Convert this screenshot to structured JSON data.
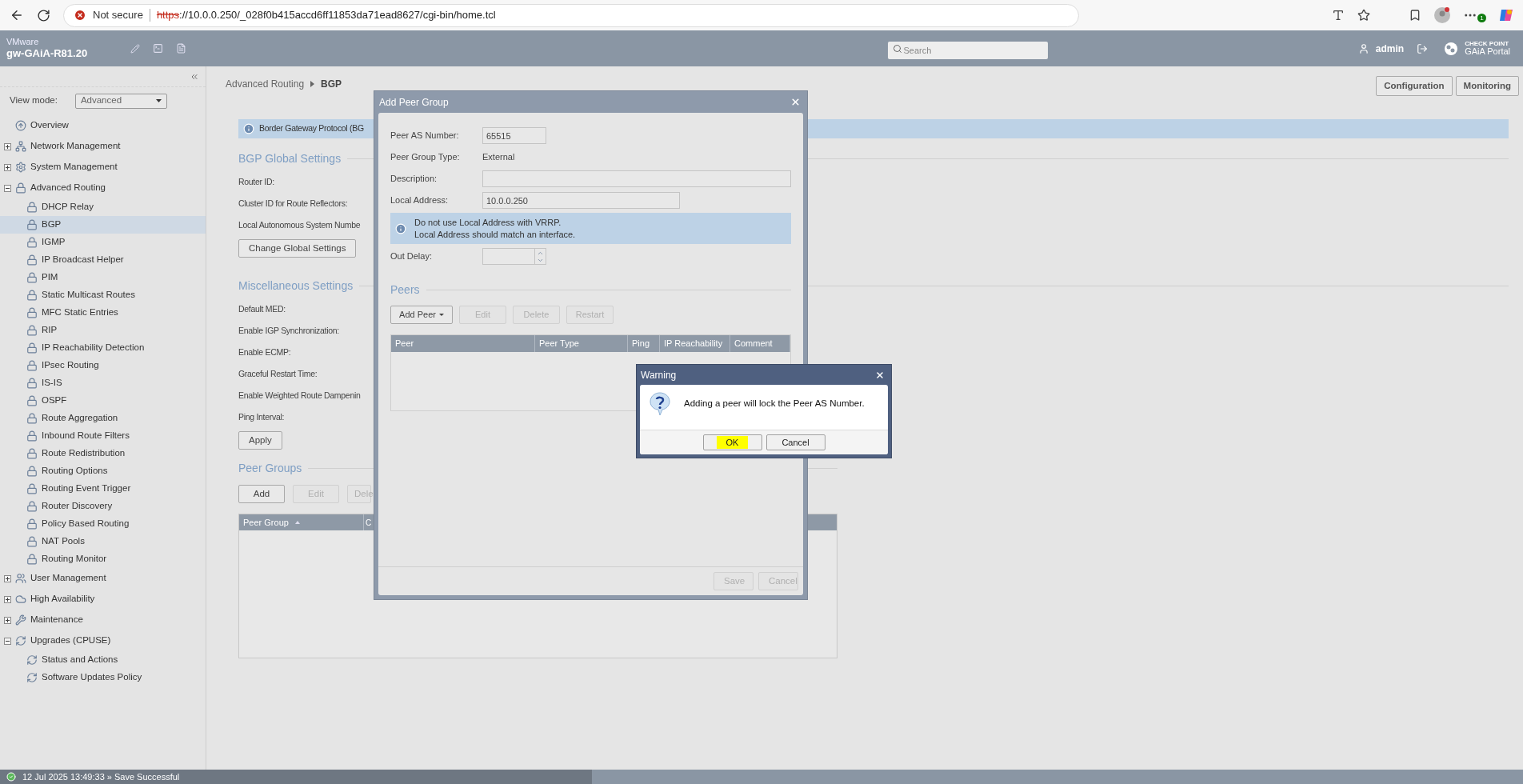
{
  "browser": {
    "security": "Not secure",
    "url_scheme": "https",
    "url_rest": "://10.0.0.250/_028f0b415accd6ff11853da71ead8627/cgi-bin/home.tcl",
    "badge": "1"
  },
  "header": {
    "vendor": "VMware",
    "hostname": "gw-GAiA-R81.20",
    "search_placeholder": "Search",
    "user": "admin",
    "brand_small": "CHECK POINT",
    "brand": "GAiA Portal"
  },
  "sidebar": {
    "view_mode_label": "View mode:",
    "view_mode": "Advanced",
    "items": [
      {
        "label": "Overview",
        "kind": "overview",
        "selected": false
      },
      {
        "label": "Network Management",
        "kind": "network",
        "expanded": false,
        "selected": false
      },
      {
        "label": "System Management",
        "kind": "system",
        "expanded": false,
        "selected": false
      },
      {
        "label": "Advanced Routing",
        "kind": "routing",
        "expanded": true,
        "selected": false,
        "children": [
          {
            "label": "DHCP Relay",
            "kind": "routing",
            "selected": false
          },
          {
            "label": "BGP",
            "kind": "routing",
            "selected": true
          },
          {
            "label": "IGMP",
            "kind": "routing",
            "selected": false
          },
          {
            "label": "IP Broadcast Helper",
            "kind": "routing",
            "selected": false
          },
          {
            "label": "PIM",
            "kind": "routing",
            "selected": false
          },
          {
            "label": "Static Multicast Routes",
            "kind": "routing",
            "selected": false
          },
          {
            "label": "MFC Static Entries",
            "kind": "routing",
            "selected": false
          },
          {
            "label": "RIP",
            "kind": "routing",
            "selected": false
          },
          {
            "label": "IP Reachability Detection",
            "kind": "routing",
            "selected": false
          },
          {
            "label": "IPsec Routing",
            "kind": "routing",
            "selected": false
          },
          {
            "label": "IS-IS",
            "kind": "routing",
            "selected": false
          },
          {
            "label": "OSPF",
            "kind": "routing",
            "selected": false
          },
          {
            "label": "Route Aggregation",
            "kind": "routing",
            "selected": false
          },
          {
            "label": "Inbound Route Filters",
            "kind": "routing",
            "selected": false
          },
          {
            "label": "Route Redistribution",
            "kind": "routing",
            "selected": false
          },
          {
            "label": "Routing Options",
            "kind": "routing",
            "selected": false
          },
          {
            "label": "Routing Event Trigger",
            "kind": "routing",
            "selected": false
          },
          {
            "label": "Router Discovery",
            "kind": "routing",
            "selected": false
          },
          {
            "label": "Policy Based Routing",
            "kind": "routing",
            "selected": false
          },
          {
            "label": "NAT Pools",
            "kind": "routing",
            "selected": false
          },
          {
            "label": "Routing Monitor",
            "kind": "routing",
            "selected": false
          }
        ]
      },
      {
        "label": "User Management",
        "kind": "users",
        "expanded": false,
        "selected": false
      },
      {
        "label": "High Availability",
        "kind": "cloud",
        "expanded": false,
        "selected": false
      },
      {
        "label": "Maintenance",
        "kind": "wrench",
        "expanded": false,
        "selected": false
      },
      {
        "label": "Upgrades (CPUSE)",
        "kind": "refresh",
        "expanded": true,
        "selected": false,
        "children": [
          {
            "label": "Status and Actions",
            "kind": "refresh",
            "selected": false
          },
          {
            "label": "Software Updates Policy",
            "kind": "refresh",
            "selected": false
          }
        ]
      }
    ]
  },
  "breadcrumb": [
    "Advanced Routing",
    "BGP"
  ],
  "mode_buttons": [
    {
      "label": "Configuration"
    },
    {
      "label": "Monitoring"
    }
  ],
  "info_text": "Border Gateway Protocol (BG",
  "sections": [
    {
      "title": "BGP Global Settings",
      "fields": [
        "Router ID:",
        "Cluster ID for Route Reflectors:",
        "Local Autonomous System Numbe"
      ],
      "button": "Change Global Settings"
    },
    {
      "title": "Miscellaneous Settings",
      "fields": [
        "Default MED:",
        "Enable IGP Synchronization:",
        "Enable ECMP:",
        "Graceful Restart Time:",
        "Enable Weighted Route Dampenin",
        "Ping Interval:"
      ],
      "button": "Apply"
    }
  ],
  "peer_groups": {
    "title": "Peer Groups",
    "buttons": [
      {
        "label": "Add",
        "disabled": false
      },
      {
        "label": "Edit",
        "disabled": true
      },
      {
        "label": "Dele",
        "disabled": true
      }
    ],
    "columns": [
      "Peer Group",
      "C"
    ]
  },
  "dialog": {
    "title": "Add Peer Group",
    "fields": [
      {
        "kind": "input",
        "label": "Peer AS Number:",
        "value": "65515"
      },
      {
        "kind": "text",
        "label": "Peer Group Type:",
        "value": "External"
      },
      {
        "kind": "input",
        "label": "Description:"
      },
      {
        "kind": "input",
        "label": "Local Address:",
        "value": "10.0.0.250"
      },
      {
        "kind": "note",
        "lines": [
          "Do not use Local Address with VRRP.",
          "Local Address should match an interface."
        ]
      },
      {
        "kind": "spin",
        "label": "Out Delay:"
      }
    ],
    "peers_title": "Peers",
    "peer_buttons": [
      {
        "label": "Add Peer",
        "dropdown": true,
        "disabled": false
      },
      {
        "label": "Edit",
        "disabled": true
      },
      {
        "label": "Delete",
        "disabled": true
      },
      {
        "label": "Restart",
        "disabled": true
      }
    ],
    "columns": [
      "Peer",
      "Peer Type",
      "Ping",
      "IP Reachability",
      "Comment"
    ],
    "footer_buttons": [
      {
        "label": "Save",
        "disabled": true
      },
      {
        "label": "Cancel",
        "disabled": true
      }
    ]
  },
  "warning": {
    "title": "Warning",
    "message": "Adding a peer will lock the Peer AS Number.",
    "buttons": [
      {
        "label": "OK",
        "highlighted": true
      },
      {
        "label": "Cancel",
        "highlighted": false
      }
    ]
  },
  "status_bar": {
    "text": "12 Jul 2025 13:49:33 » Save Successful"
  }
}
